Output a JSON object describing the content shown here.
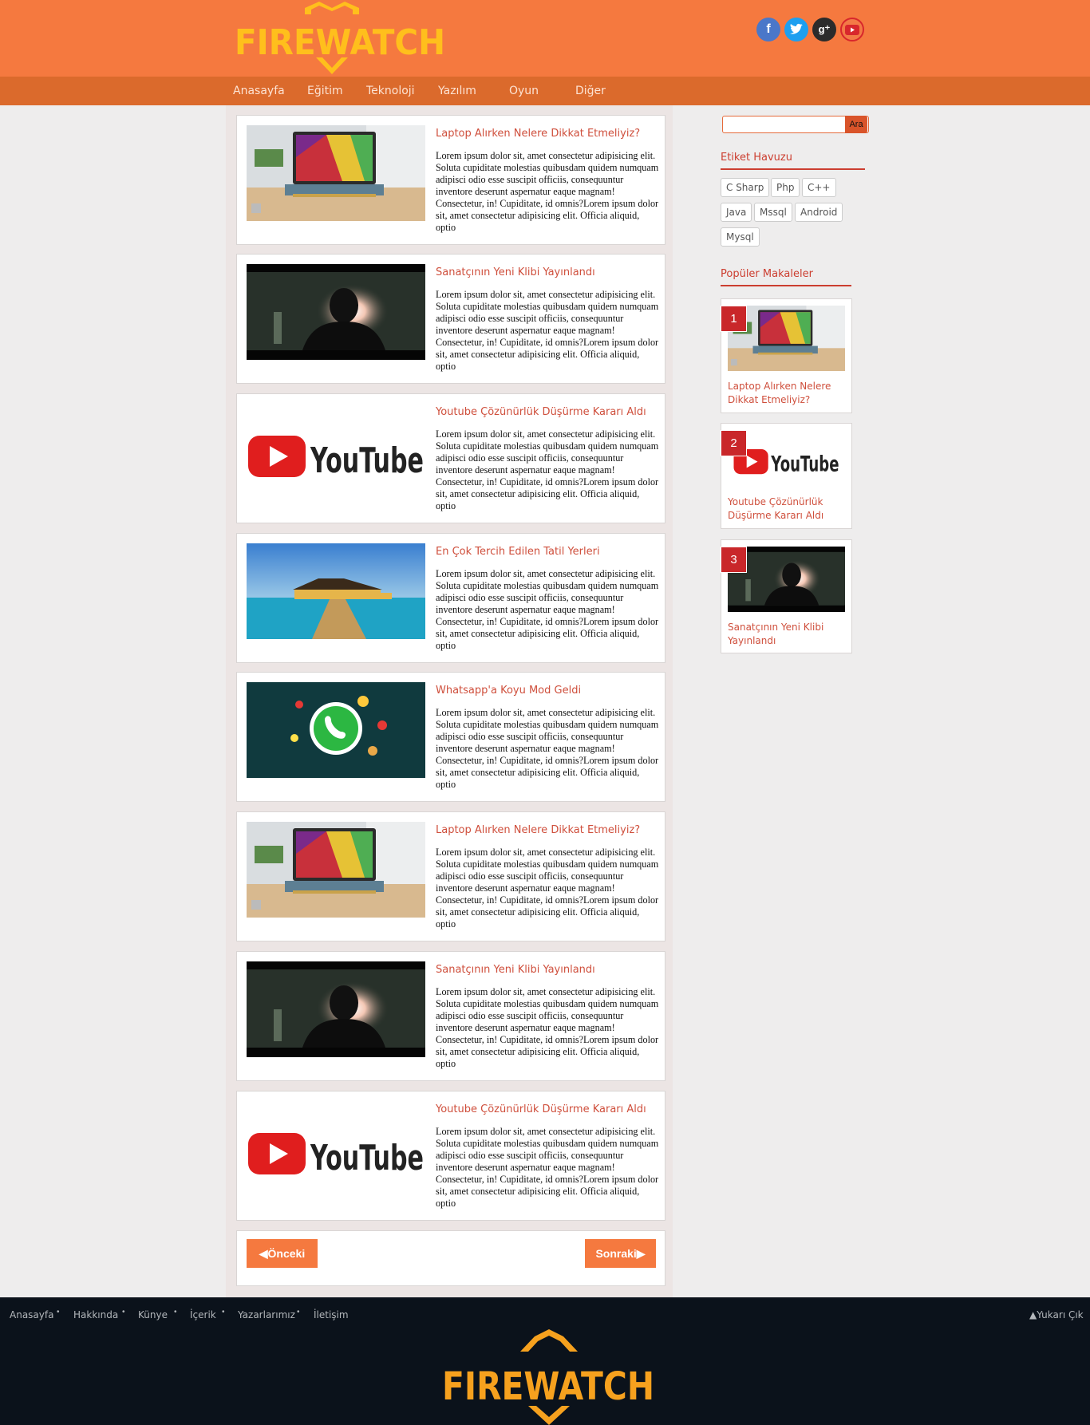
{
  "header": {
    "logo": "FIREWATCH",
    "social": [
      "facebook-icon",
      "twitter-icon",
      "google-plus-icon",
      "youtube-icon"
    ]
  },
  "nav": {
    "items": [
      "Anasayfa",
      "Eğitim",
      "Teknoloji",
      "Yazılım",
      "Oyun",
      "Diğer"
    ]
  },
  "posts": [
    {
      "title": "Laptop Alırken Nelere Dikkat Etmeliyiz?",
      "image": "laptop"
    },
    {
      "title": "Sanatçının Yeni Klibi Yayınlandı",
      "image": "singer"
    },
    {
      "title": "Youtube Çözünürlük Düşürme Kararı Aldı",
      "image": "youtube"
    },
    {
      "title": "En Çok Tercih Edilen Tatil Yerleri",
      "image": "resort"
    },
    {
      "title": "Whatsapp'a Koyu Mod Geldi",
      "image": "whatsapp"
    },
    {
      "title": "Laptop Alırken Nelere Dikkat Etmeliyiz?",
      "image": "laptop"
    },
    {
      "title": "Sanatçının Yeni Klibi Yayınlandı",
      "image": "singer"
    },
    {
      "title": "Youtube Çözünürlük Düşürme Kararı Aldı",
      "image": "youtube"
    }
  ],
  "post_body": "Lorem ipsum dolor sit, amet consectetur adipisicing elit. Soluta cupiditate molestias quibusdam quidem numquam adipisci odio esse suscipit officiis, consequuntur inventore deserunt aspernatur eaque magnam! Consectetur, in! Cupiditate, id omnis?Lorem ipsum dolor sit, amet consectetur adipisicing elit. Officia aliquid, optio",
  "pager": {
    "prev": "◀Önceki",
    "next": "Sonraki▶"
  },
  "sidebar": {
    "search_button": "Ara",
    "search_value": "",
    "tags_title": "Etiket Havuzu",
    "tags": [
      "C Sharp",
      "Php",
      "C++",
      "Java",
      "Mssql",
      "Android",
      "Mysql"
    ],
    "popular_title": "Popüler Makaleler",
    "popular": [
      {
        "rank": "1",
        "title": "Laptop Alırken Nelere Dikkat Etmeliyiz?",
        "image": "laptop"
      },
      {
        "rank": "2",
        "title": "Youtube Çözünürlük Düşürme Kararı Aldı",
        "image": "youtube"
      },
      {
        "rank": "3",
        "title": "Sanatçının Yeni Klibi Yayınlandı",
        "image": "singer"
      }
    ]
  },
  "footer": {
    "links": [
      "Anasayfa",
      "Hakkında",
      "Künye",
      "İçerik",
      "Yazarlarımız",
      "İletişim"
    ],
    "back_to_top": "▲Yukarı Çık",
    "logo": "FIREWATCH"
  },
  "colors": {
    "header": "#f5793f",
    "nav": "#db6a2c",
    "accent": "#cf4f3c",
    "footer": "#0b121b",
    "logo": "#ffbf1c"
  }
}
